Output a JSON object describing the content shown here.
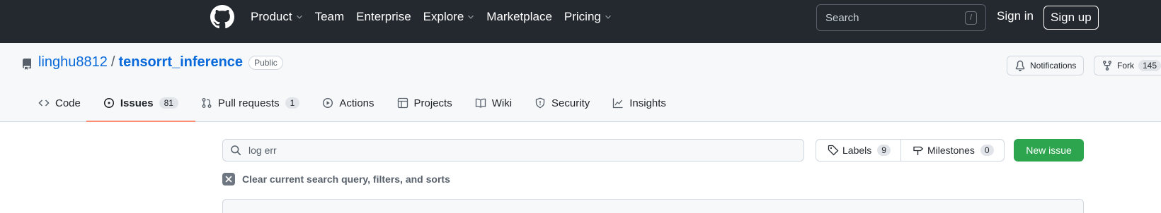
{
  "header": {
    "nav": [
      {
        "label": "Product",
        "dropdown": true
      },
      {
        "label": "Team",
        "dropdown": false
      },
      {
        "label": "Enterprise",
        "dropdown": false
      },
      {
        "label": "Explore",
        "dropdown": true
      },
      {
        "label": "Marketplace",
        "dropdown": false
      },
      {
        "label": "Pricing",
        "dropdown": true
      }
    ],
    "search_placeholder": "Search",
    "search_shortcut": "/",
    "sign_in": "Sign in",
    "sign_up": "Sign up"
  },
  "repo": {
    "owner": "linghu8812",
    "separator": "/",
    "name": "tensorrt_inference",
    "visibility": "Public",
    "notifications_label": "Notifications",
    "fork_label": "Fork",
    "fork_count": "145"
  },
  "tabs": [
    {
      "label": "Code",
      "icon": "code-icon",
      "counter": null,
      "selected": false
    },
    {
      "label": "Issues",
      "icon": "issue-opened-icon",
      "counter": "81",
      "selected": true
    },
    {
      "label": "Pull requests",
      "icon": "pull-request-icon",
      "counter": "1",
      "selected": false
    },
    {
      "label": "Actions",
      "icon": "play-icon",
      "counter": null,
      "selected": false
    },
    {
      "label": "Projects",
      "icon": "table-icon",
      "counter": null,
      "selected": false
    },
    {
      "label": "Wiki",
      "icon": "book-icon",
      "counter": null,
      "selected": false
    },
    {
      "label": "Security",
      "icon": "shield-icon",
      "counter": null,
      "selected": false
    },
    {
      "label": "Insights",
      "icon": "graph-icon",
      "counter": null,
      "selected": false
    }
  ],
  "filter": {
    "query": "log err",
    "labels_label": "Labels",
    "labels_count": "9",
    "milestones_label": "Milestones",
    "milestones_count": "0",
    "new_issue": "New issue",
    "clear_text": "Clear current search query, filters, and sorts"
  },
  "colors": {
    "header_bg": "#24292f",
    "link_blue": "#0969da",
    "primary_green": "#2da44e",
    "tab_underline": "#fd8c73"
  }
}
